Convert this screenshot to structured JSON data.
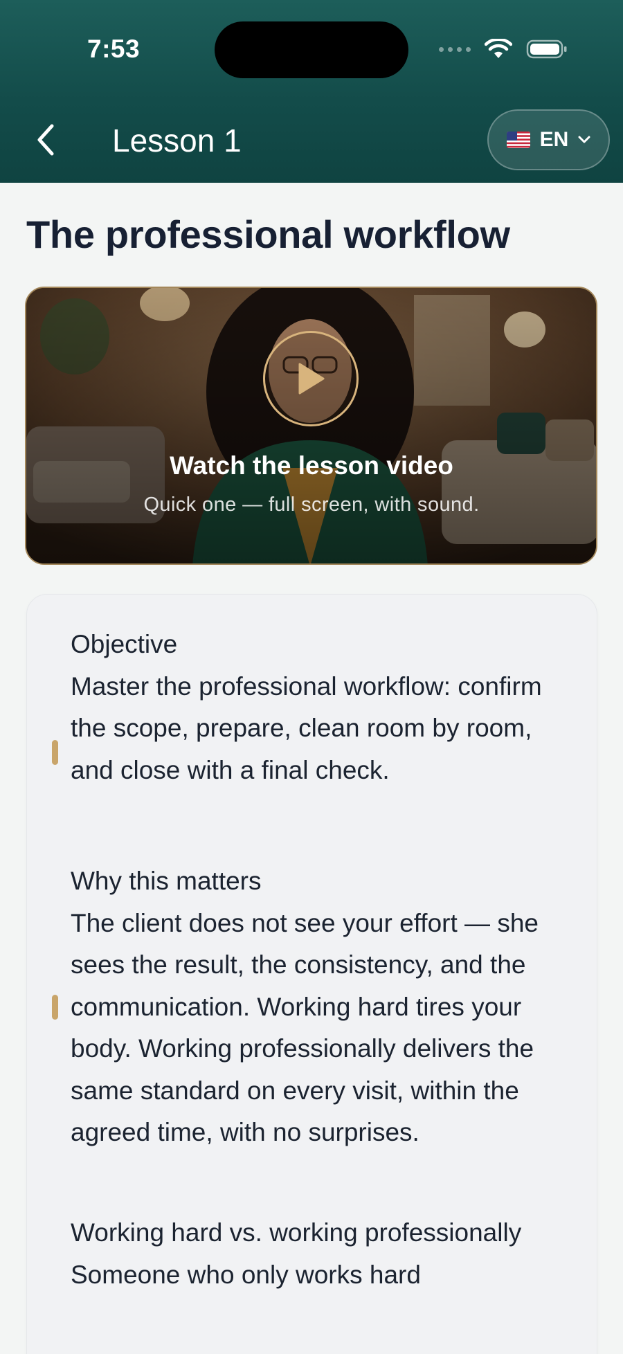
{
  "status_bar": {
    "time": "7:53"
  },
  "nav": {
    "back_icon": "chevron-left-icon",
    "title": "Lesson 1",
    "language": {
      "code": "EN",
      "flag_icon": "us-flag-icon",
      "chevron_icon": "chevron-down-icon"
    }
  },
  "page": {
    "title": "The professional workflow"
  },
  "video": {
    "play_icon": "play-icon",
    "title": "Watch the lesson video",
    "subtitle": "Quick one — full screen, with sound."
  },
  "sections": [
    {
      "label": "Objective",
      "body": "Master the professional workflow: confirm the scope, prepare, clean room by room, and close with a final check."
    },
    {
      "label": "Why this matters",
      "body": "The client does not see your effort — she sees the result, the consistency, and the communication. Working hard tires your body. Working professionally delivers the same standard on every visit, within the agreed time, with no surprises."
    },
    {
      "label": "Working hard vs. working professionally",
      "body": "Someone who only works hard"
    }
  ],
  "colors": {
    "header": "#134c4a",
    "accent": "#c9a56a",
    "background": "#f3f5f4",
    "card": "#f1f2f4"
  }
}
